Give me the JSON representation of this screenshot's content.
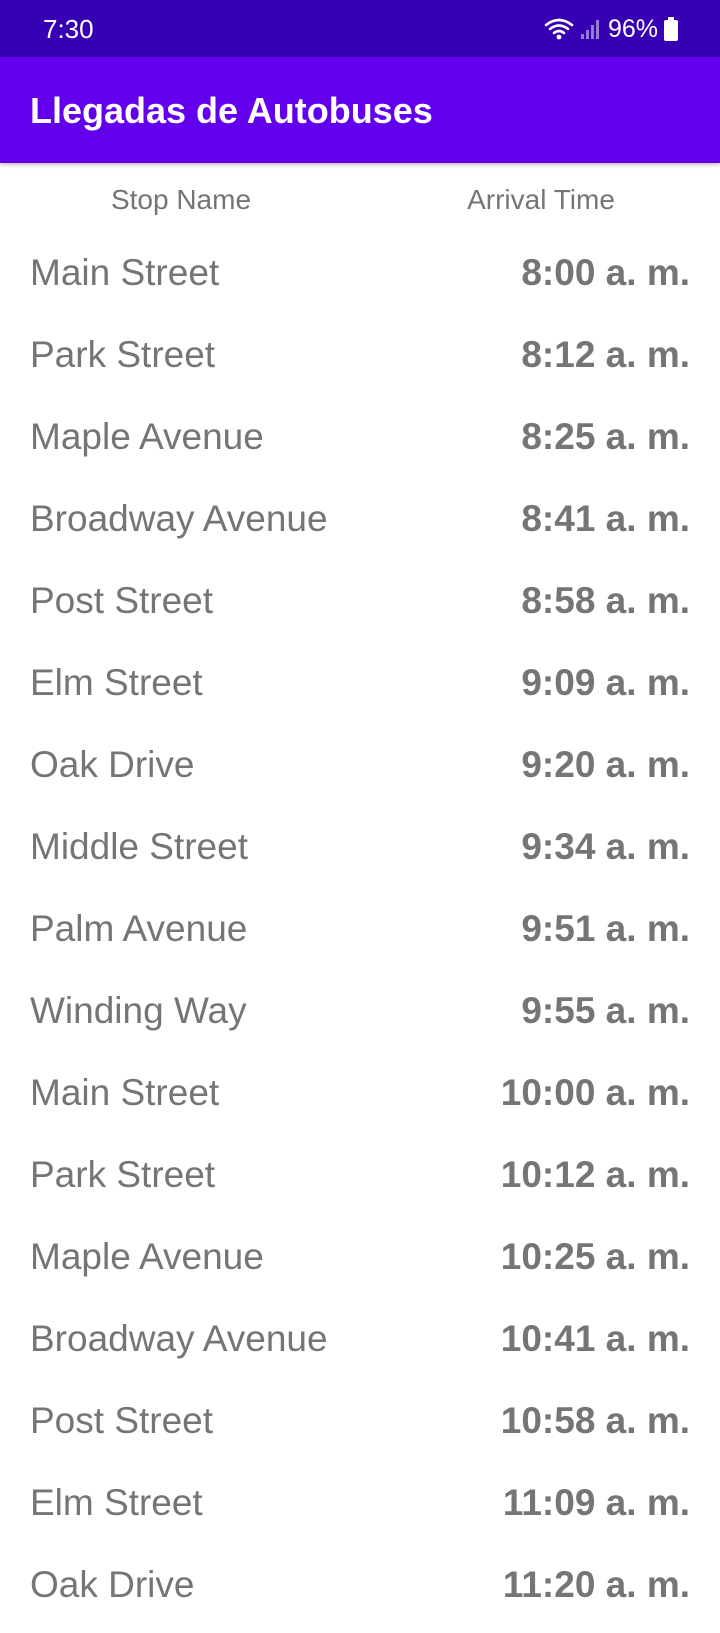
{
  "status_bar": {
    "time": "7:30",
    "battery": "96%",
    "icons": [
      "wifi-icon",
      "signal-icon",
      "battery-icon"
    ]
  },
  "app_bar": {
    "title": "Llegadas de Autobuses",
    "color": "#6200ee",
    "status_color": "#3700b3"
  },
  "table": {
    "headers": {
      "stop": "Stop Name",
      "arrival": "Arrival Time"
    },
    "rows": [
      {
        "stop": "Main Street",
        "time": "8:00 a. m."
      },
      {
        "stop": "Park Street",
        "time": "8:12 a. m."
      },
      {
        "stop": "Maple Avenue",
        "time": "8:25 a. m."
      },
      {
        "stop": "Broadway Avenue",
        "time": "8:41 a. m."
      },
      {
        "stop": "Post Street",
        "time": "8:58 a. m."
      },
      {
        "stop": "Elm Street",
        "time": "9:09 a. m."
      },
      {
        "stop": "Oak Drive",
        "time": "9:20 a. m."
      },
      {
        "stop": "Middle Street",
        "time": "9:34 a. m."
      },
      {
        "stop": "Palm Avenue",
        "time": "9:51 a. m."
      },
      {
        "stop": "Winding Way",
        "time": "9:55 a. m."
      },
      {
        "stop": "Main Street",
        "time": "10:00 a. m."
      },
      {
        "stop": "Park Street",
        "time": "10:12 a. m."
      },
      {
        "stop": "Maple Avenue",
        "time": "10:25 a. m."
      },
      {
        "stop": "Broadway Avenue",
        "time": "10:41 a. m."
      },
      {
        "stop": "Post Street",
        "time": "10:58 a. m."
      },
      {
        "stop": "Elm Street",
        "time": "11:09 a. m."
      },
      {
        "stop": "Oak Drive",
        "time": "11:20 a. m."
      }
    ]
  }
}
